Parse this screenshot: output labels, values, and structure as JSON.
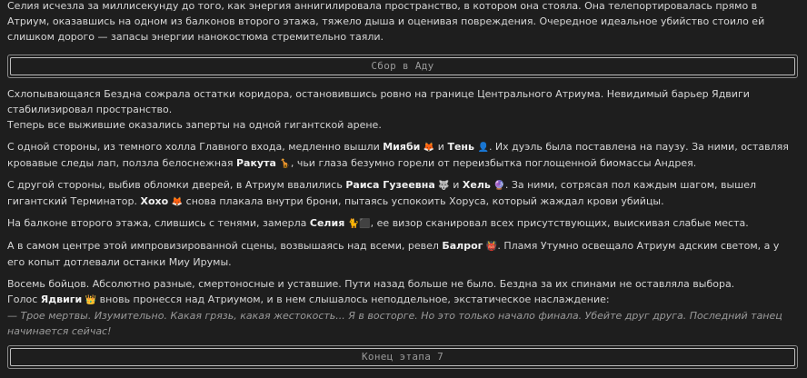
{
  "intro": {
    "text": "Селия исчезла за миллисекунду до того, как энергия аннигилировала пространство, в котором она стояла. Она телепортировалась прямо в Атриум, оказавшись на одном из балконов второго этажа, тяжело дыша и оценивая повреждения. Очередное идеальное убийство стоило ей слишком дорого — запасы энергии нанокостюма стремительно таяли."
  },
  "section_start": {
    "label": "Сбор в Аду"
  },
  "para1": {
    "line1": "Схлопывающаяся Бездна сожрала остатки коридора, остановившись ровно на границе Центрального Атриума. Невидимый барьер Ядвиги стабилизировал пространство.",
    "line2": "Теперь все выжившие оказались заперты на одной гигантской арене."
  },
  "para2": {
    "t1": "С одной стороны, из темного холла Главного входа, медленно вышли ",
    "n1": "Мияби",
    "e1": "🦊",
    "t2": " и ",
    "n2": "Тень",
    "e2": "👤",
    "t3": ". Их дуэль была поставлена на паузу. За ними, оставляя кровавые следы лап, ползла белоснежная ",
    "n3": "Ракута",
    "e3": "🦒",
    "t4": ", чьи глаза безумно горели от переизбытка поглощенной биомассы Андрея."
  },
  "para3": {
    "t1": "С другой стороны, выбив обломки дверей, в Атриум ввалились ",
    "n1": "Раиса Гузеевна",
    "e1": "🐺",
    "t2": " и ",
    "n2": "Хель",
    "e2": "🔮",
    "t3": ". За ними, сотрясая пол каждым шагом, вышел гигантский Терминатор. ",
    "n3": "Хохо",
    "e3": "🦊",
    "t4": " снова плакала внутри брони, пытаясь успокоить Хоруса, который жаждал крови убийцы."
  },
  "para4": {
    "t1": "На балконе второго этажа, слившись с тенями, замерла ",
    "n1": "Селия",
    "e1": "🐈",
    "e2": "⬛",
    "t2": ", ее визор сканировал всех присутствующих, выискивая слабые места."
  },
  "para5": {
    "t1": "А в самом центре этой импровизированной сцены, возвышаясь над всеми, ревел ",
    "n1": "Балрог",
    "e1": "👹",
    "t2": ". Пламя Утумно освещало Атриум адским светом, а у его копыт дотлевали останки Миу Ирумы."
  },
  "para6": {
    "line1": "Восемь бойцов. Абсолютно разные, смертоносные и уставшие. Пути назад больше не было. Бездна за их спинами не оставляла выбора.",
    "t1": "Голос ",
    "n1": "Ядвиги",
    "e1": "👑",
    "t2": " вновь пронесся над Атриумом, и в нем слышалось неподдельное, экстатическое наслаждение:",
    "dash": "— ",
    "quote": "Трое мертвы. Изумительно. Какая грязь, какая жестокость... Я в восторге. Но это только начало финала. Убейте друг друга. Последний танец начинается сейчас!"
  },
  "section_end": {
    "label": "Конец этапа 7"
  }
}
